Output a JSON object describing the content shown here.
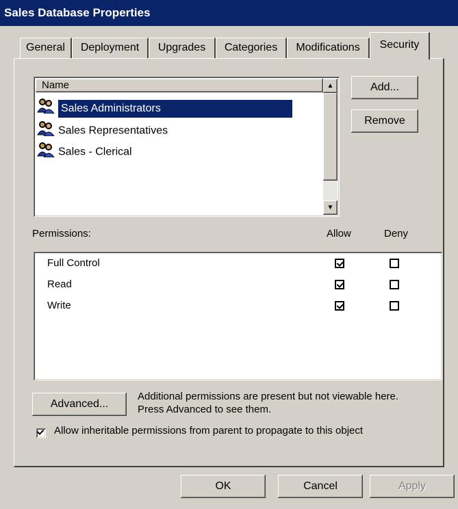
{
  "window": {
    "title": "Sales Database Properties"
  },
  "tabs": [
    {
      "label": "General",
      "active": false
    },
    {
      "label": "Deployment",
      "active": false
    },
    {
      "label": "Upgrades",
      "active": false
    },
    {
      "label": "Categories",
      "active": false
    },
    {
      "label": "Modifications",
      "active": false
    },
    {
      "label": "Security",
      "active": true
    }
  ],
  "names_list": {
    "header": "Name",
    "items": [
      {
        "label": "Sales Administrators",
        "icon": "user-group-icon",
        "selected": true
      },
      {
        "label": "Sales Representatives",
        "icon": "user-group-icon",
        "selected": false
      },
      {
        "label": "Sales - Clerical",
        "icon": "user-group-icon",
        "selected": false
      }
    ]
  },
  "buttons": {
    "add": "Add...",
    "remove": "Remove",
    "advanced": "Advanced...",
    "ok": "OK",
    "cancel": "Cancel",
    "apply": "Apply"
  },
  "permissions": {
    "label": "Permissions:",
    "allow_header": "Allow",
    "deny_header": "Deny",
    "rows": [
      {
        "name": "Full Control",
        "allow": true,
        "deny": false
      },
      {
        "name": "Read",
        "allow": true,
        "deny": false
      },
      {
        "name": "Write",
        "allow": true,
        "deny": false
      }
    ]
  },
  "advanced_note": "Additional permissions are present but not viewable here. Press Advanced to see them.",
  "inherit": {
    "label": "Allow inheritable permissions from parent to propagate to this object",
    "checked": true
  },
  "colors": {
    "dialog": "#d4d0c8",
    "titlebar": "#0a246a",
    "selection": "#0a246a"
  }
}
